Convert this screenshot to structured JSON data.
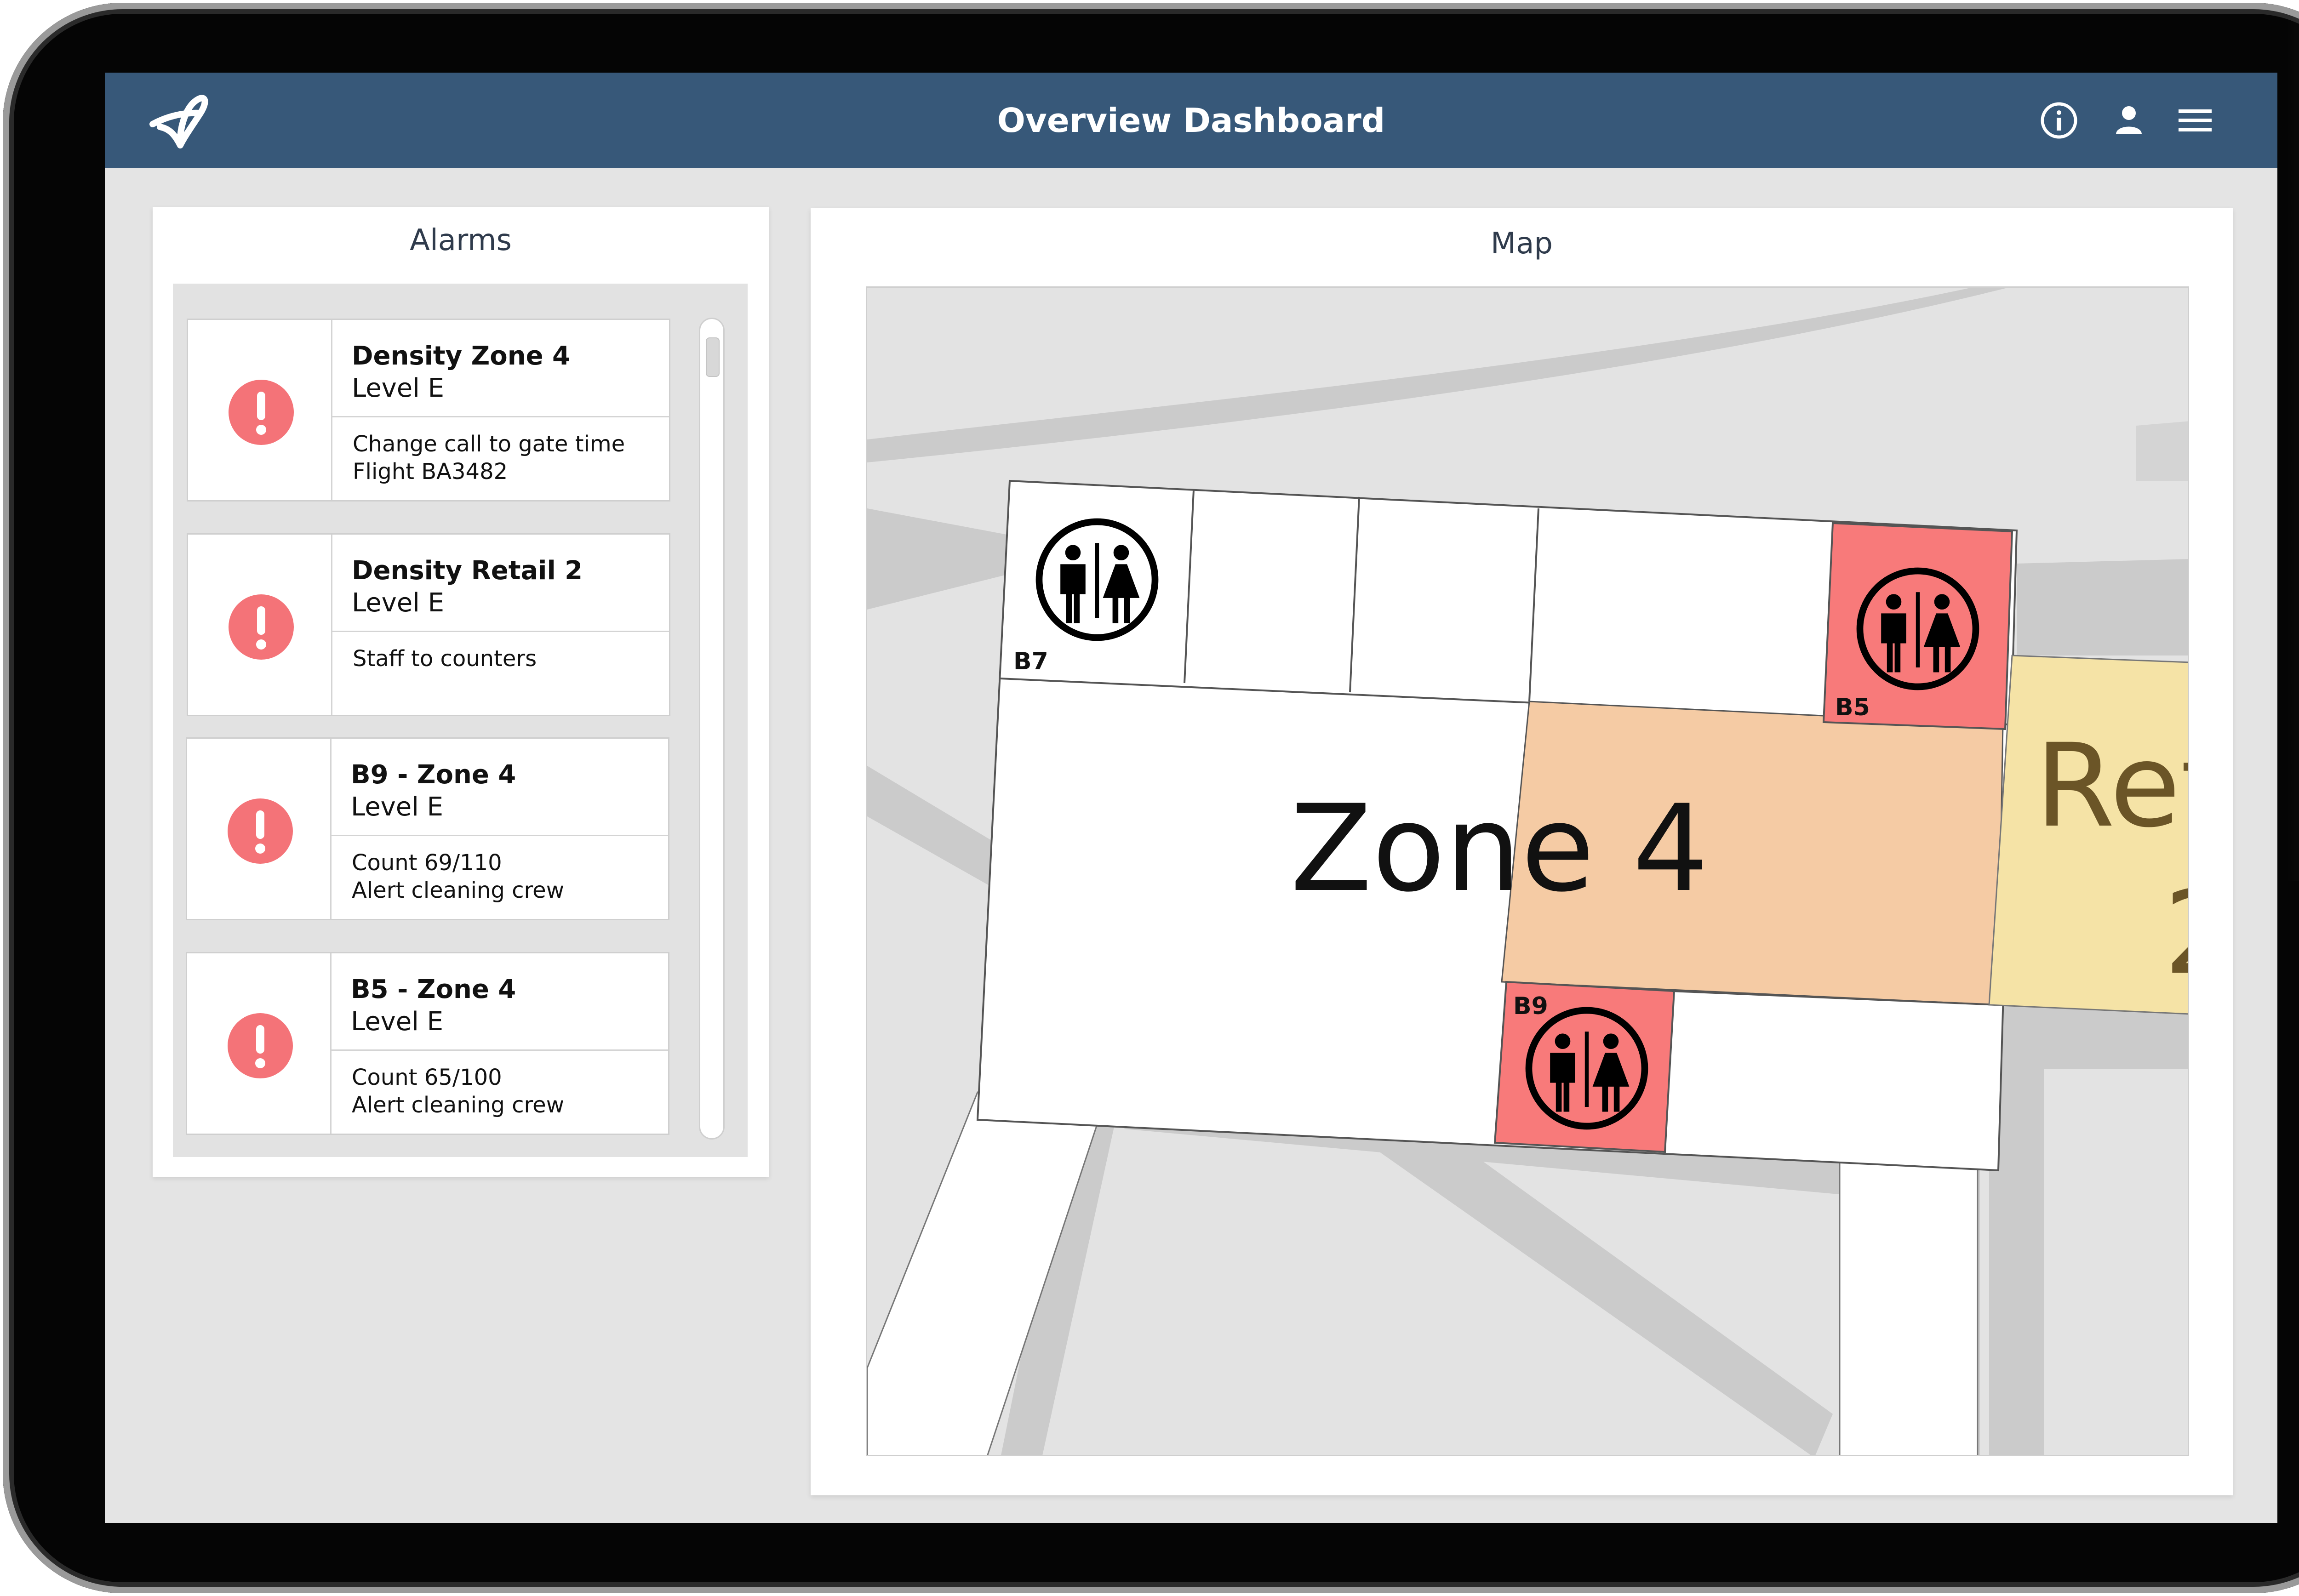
{
  "header": {
    "title": "Overview Dashboard",
    "background_color": "#375879",
    "icons": [
      "logo-icon",
      "info-icon",
      "user-icon",
      "menu-icon"
    ]
  },
  "alarms": {
    "title": "Alarms",
    "items": [
      {
        "title": "Density Zone 4",
        "level": "Level E",
        "message_line1": "Change call to gate time",
        "message_line2": "Flight BA3482",
        "icon": "alert-icon"
      },
      {
        "title": "Density Retail 2",
        "level": "Level E",
        "message_line1": "Staff to counters",
        "message_line2": "",
        "icon": "alert-icon"
      },
      {
        "title": "B9 - Zone 4",
        "level": "Level E",
        "message_line1": "Count 69/110",
        "message_line2": "Alert cleaning crew",
        "icon": "alert-icon"
      },
      {
        "title": "B5 - Zone 4",
        "level": "Level E",
        "message_line1": "Count 65/100",
        "message_line2": "Alert cleaning crew",
        "icon": "alert-icon"
      }
    ],
    "alert_color": "#f47378"
  },
  "map": {
    "title": "Map",
    "zone_label": "Zone 4",
    "retail_label": "Ret",
    "retail_label_2": "2",
    "restrooms": [
      {
        "label": "B7",
        "status": "normal"
      },
      {
        "label": "B5",
        "status": "alert"
      },
      {
        "label": "B9",
        "status": "alert"
      }
    ],
    "colors": {
      "zone_density": "#f5cba4",
      "retail_density": "#f5e3a6",
      "restroom_alert": "#f87a7a",
      "building": "#ffffff",
      "ground": "#e3e3e3",
      "path": "#cbcbcb"
    }
  }
}
